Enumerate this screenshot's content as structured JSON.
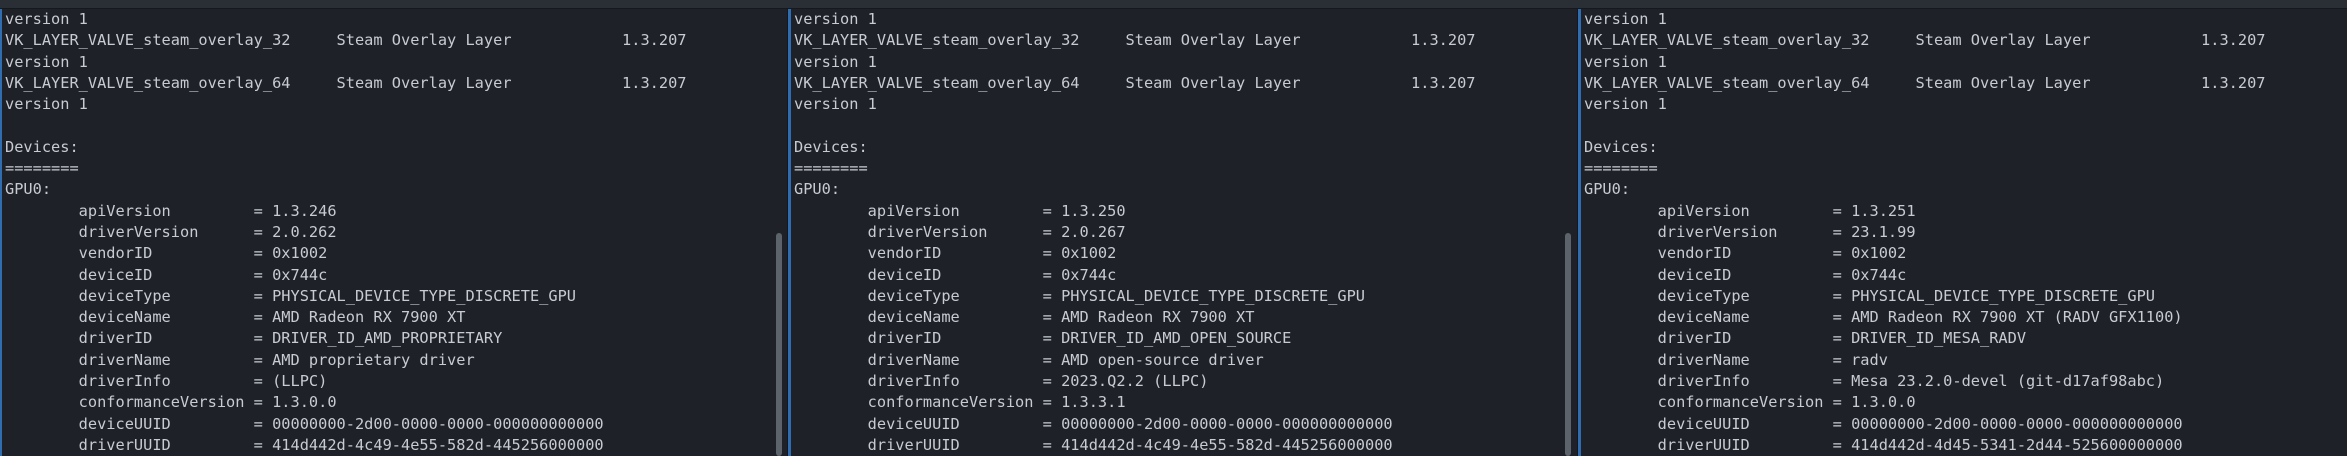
{
  "panes": [
    {
      "lines": [
        "version 1",
        "VK_LAYER_VALVE_steam_overlay_32     Steam Overlay Layer            1.3.207",
        "version 1",
        "VK_LAYER_VALVE_steam_overlay_64     Steam Overlay Layer            1.3.207",
        "version 1",
        "",
        "Devices:",
        "========",
        "GPU0:",
        "        apiVersion         = 1.3.246",
        "        driverVersion      = 2.0.262",
        "        vendorID           = 0x1002",
        "        deviceID           = 0x744c",
        "        deviceType         = PHYSICAL_DEVICE_TYPE_DISCRETE_GPU",
        "        deviceName         = AMD Radeon RX 7900 XT",
        "        driverID           = DRIVER_ID_AMD_PROPRIETARY",
        "        driverName         = AMD proprietary driver",
        "        driverInfo         = (LLPC)",
        "        conformanceVersion = 1.3.0.0",
        "        deviceUUID         = 00000000-2d00-0000-0000-000000000000",
        "        driverUUID         = 414d442d-4c49-4e55-582d-445256000000"
      ]
    },
    {
      "lines": [
        "version 1",
        "VK_LAYER_VALVE_steam_overlay_32     Steam Overlay Layer            1.3.207",
        "version 1",
        "VK_LAYER_VALVE_steam_overlay_64     Steam Overlay Layer            1.3.207",
        "version 1",
        "",
        "Devices:",
        "========",
        "GPU0:",
        "        apiVersion         = 1.3.250",
        "        driverVersion      = 2.0.267",
        "        vendorID           = 0x1002",
        "        deviceID           = 0x744c",
        "        deviceType         = PHYSICAL_DEVICE_TYPE_DISCRETE_GPU",
        "        deviceName         = AMD Radeon RX 7900 XT",
        "        driverID           = DRIVER_ID_AMD_OPEN_SOURCE",
        "        driverName         = AMD open-source driver",
        "        driverInfo         = 2023.Q2.2 (LLPC)",
        "        conformanceVersion = 1.3.3.1",
        "        deviceUUID         = 00000000-2d00-0000-0000-000000000000",
        "        driverUUID         = 414d442d-4c49-4e55-582d-445256000000"
      ]
    },
    {
      "lines": [
        "version 1",
        "VK_LAYER_VALVE_steam_overlay_32     Steam Overlay Layer            1.3.207",
        "version 1",
        "VK_LAYER_VALVE_steam_overlay_64     Steam Overlay Layer            1.3.207",
        "version 1",
        "",
        "Devices:",
        "========",
        "GPU0:",
        "        apiVersion         = 1.3.251",
        "        driverVersion      = 23.1.99",
        "        vendorID           = 0x1002",
        "        deviceID           = 0x744c",
        "        deviceType         = PHYSICAL_DEVICE_TYPE_DISCRETE_GPU",
        "        deviceName         = AMD Radeon RX 7900 XT (RADV GFX1100)",
        "        driverID           = DRIVER_ID_MESA_RADV",
        "        driverName         = radv",
        "        driverInfo         = Mesa 23.2.0-devel (git-d17af98abc)",
        "        conformanceVersion = 1.3.0.0",
        "        deviceUUID         = 00000000-2d00-0000-0000-000000000000",
        "        driverUUID         = 414d442d-4d45-5341-2d44-525600000000"
      ]
    }
  ],
  "colors": {
    "background": "#1e2228",
    "text": "#c8ccd2",
    "active_border": "#2f6db0",
    "scrollbar": "#5d636b"
  }
}
